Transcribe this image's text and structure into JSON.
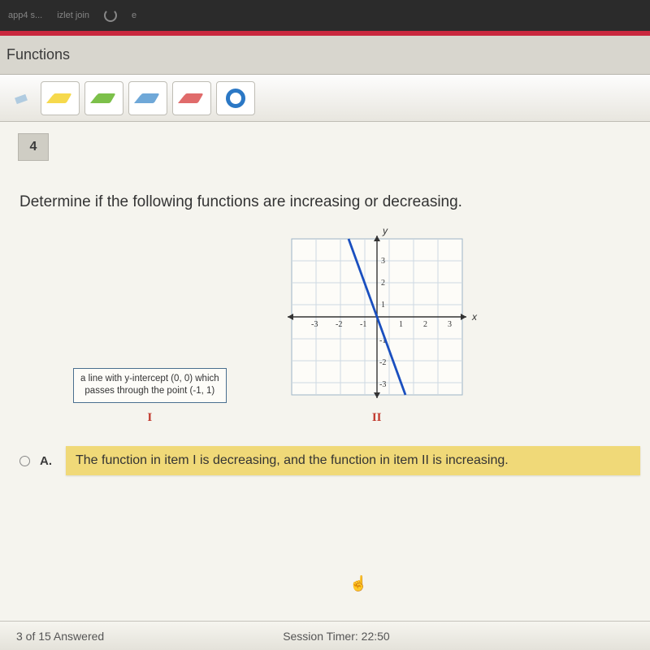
{
  "browser": {
    "tab1": "app4 s...",
    "tab2": "izlet join",
    "tab3": "e"
  },
  "header": {
    "title": "Functions"
  },
  "toolbar": {
    "tools": [
      "highlighter-yellow",
      "highlighter-green",
      "highlighter-blue",
      "highlighter-red",
      "clear-highlight"
    ]
  },
  "question": {
    "number": "4",
    "prompt": "Determine if the following functions are increasing or decreasing.",
    "itemI": {
      "desc_l1": "a line with y-intercept (0, 0) which",
      "desc_l2": "passes through the point (-1, 1)",
      "label": "I"
    },
    "itemII": {
      "label": "II",
      "y_axis": "y",
      "x_axis": "x",
      "ticks_x": [
        "-3",
        "-2",
        "-1",
        "1",
        "2",
        "3"
      ],
      "ticks_y_pos": [
        "1",
        "2",
        "3"
      ],
      "ticks_y_neg": [
        "-1",
        "-2",
        "-3"
      ]
    }
  },
  "choices": {
    "A": {
      "letter": "A.",
      "text": "The function in item I is decreasing, and the function in item II is increasing."
    }
  },
  "footer": {
    "progress": "3 of 15 Answered",
    "timer": "Session Timer: 22:50"
  },
  "chart_data": {
    "type": "line",
    "title": "",
    "xlabel": "x",
    "ylabel": "y",
    "xlim": [
      -3.5,
      3.5
    ],
    "ylim": [
      -3.5,
      3.5
    ],
    "series": [
      {
        "name": "line",
        "x": [
          -1.3,
          1.3
        ],
        "y": [
          3.5,
          -3.5
        ]
      }
    ]
  }
}
